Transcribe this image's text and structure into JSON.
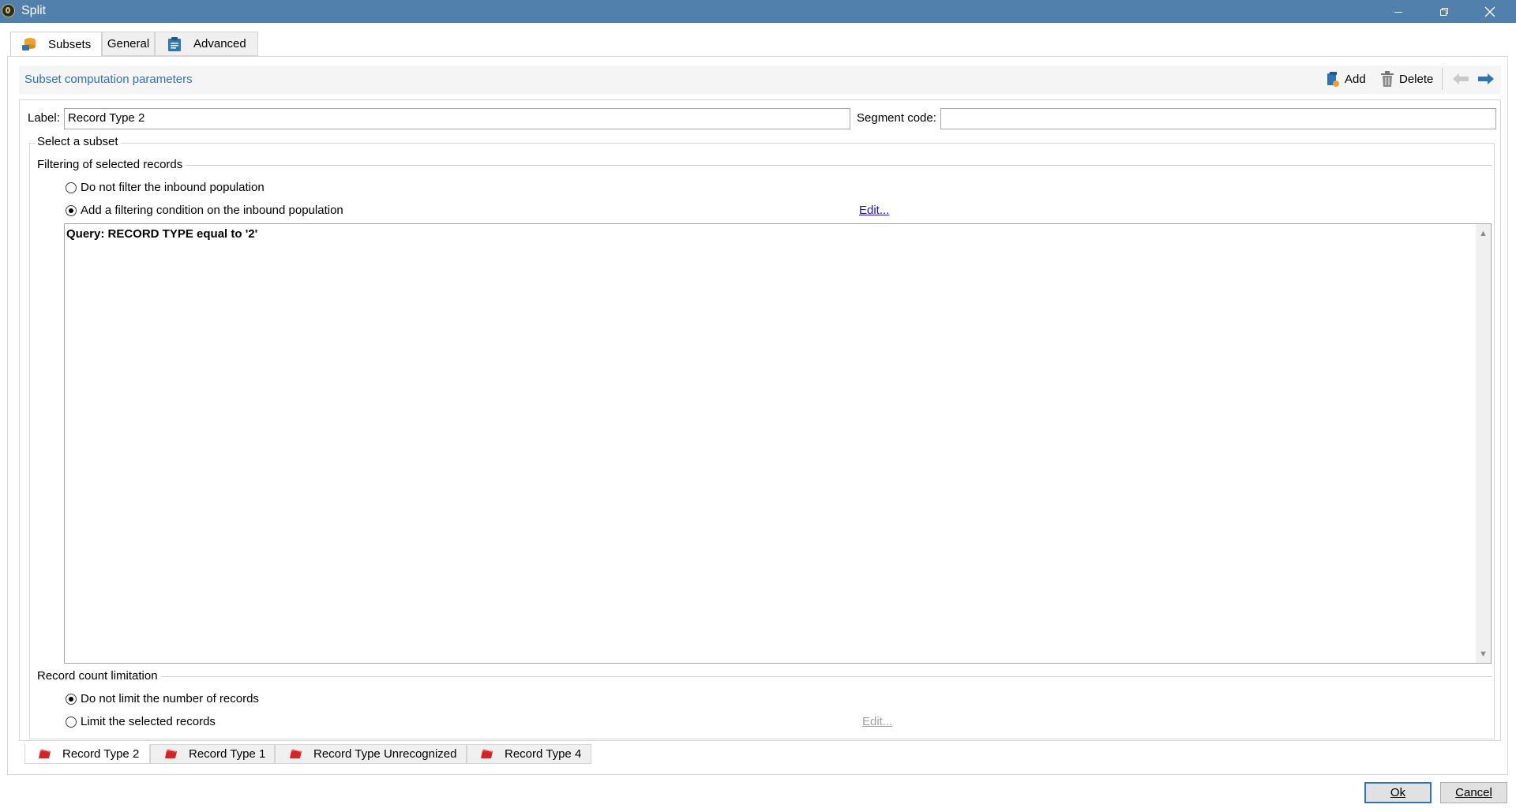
{
  "window": {
    "title": "Split"
  },
  "tabs": [
    {
      "label": "Subsets",
      "icon": "database-icon"
    },
    {
      "label": "General"
    },
    {
      "label": "Advanced",
      "icon": "clipboard-icon"
    }
  ],
  "section": {
    "title": "Subset computation parameters"
  },
  "toolbar": {
    "add_label": "Add",
    "delete_label": "Delete"
  },
  "form": {
    "label_caption": "Label:",
    "label_value": "Record Type 2",
    "segment_caption": "Segment code:",
    "segment_value": ""
  },
  "subset": {
    "legend": "Select a subset",
    "filtering": {
      "heading": "Filtering of selected records",
      "option_no_filter": "Do not filter the inbound population",
      "option_add_condition": "Add a filtering condition on the inbound population",
      "selected": "add_condition",
      "edit_link": "Edit...",
      "query_text": "Query: RECORD TYPE equal to '2'"
    },
    "limitation": {
      "heading": "Record count limitation",
      "option_no_limit": "Do not limit the number of records",
      "option_limit": "Limit the selected records",
      "selected": "no_limit",
      "edit_link": "Edit..."
    }
  },
  "record_tabs": [
    {
      "label": "Record Type 2",
      "active": true
    },
    {
      "label": "Record Type 1",
      "active": false
    },
    {
      "label": "Record Type Unrecognized",
      "active": false
    },
    {
      "label": "Record Type 4",
      "active": false
    }
  ],
  "buttons": {
    "ok": "Ok",
    "cancel": "Cancel"
  },
  "colors": {
    "titlebar": "#5180ad",
    "accent_blue": "#2f74b5",
    "link": "#1a12c8",
    "record_icon_red": "#d42424"
  }
}
